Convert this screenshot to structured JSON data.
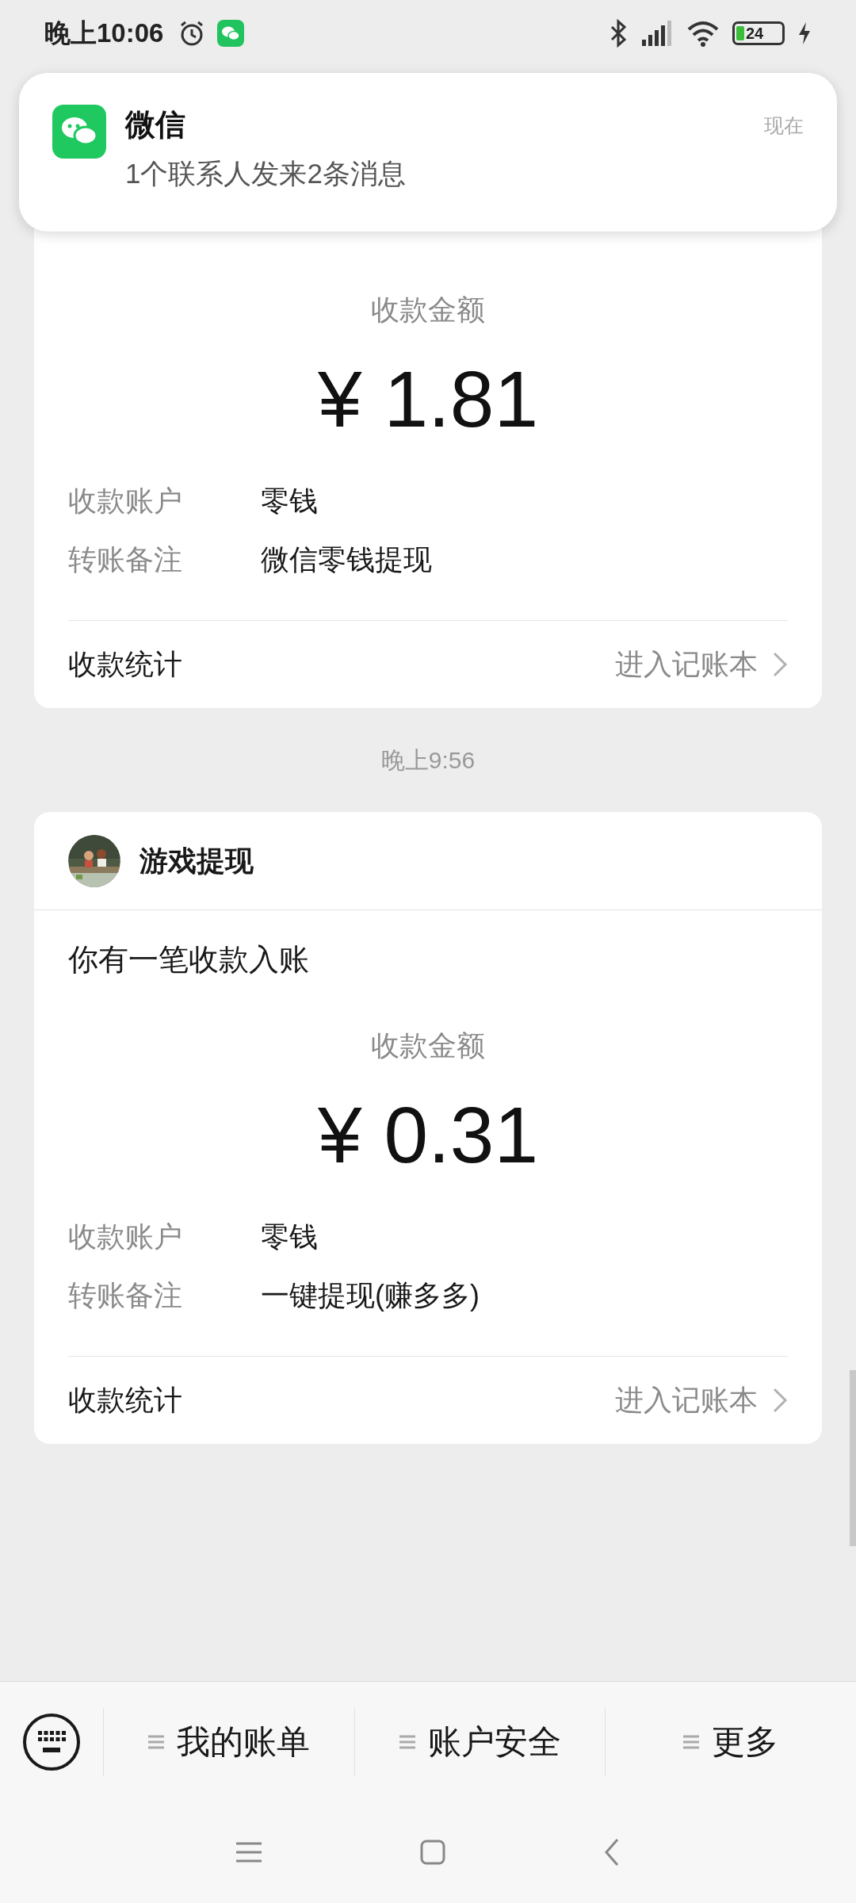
{
  "status_bar": {
    "time": "晚上10:06",
    "battery": "24"
  },
  "notification": {
    "app": "微信",
    "message": "1个联系人发来2条消息",
    "time": "现在"
  },
  "cards": [
    {
      "amount_label": "收款金额",
      "amount": "¥ 1.81",
      "rows": [
        {
          "label": "收款账户",
          "value": "零钱"
        },
        {
          "label": "转账备注",
          "value": "微信零钱提现"
        }
      ],
      "stats_label": "收款统计",
      "stats_link": "进入记账本"
    },
    {
      "timestamp": "晚上9:56",
      "sender": "游戏提现",
      "title": "你有一笔收款入账",
      "amount_label": "收款金额",
      "amount": "¥ 0.31",
      "rows": [
        {
          "label": "收款账户",
          "value": "零钱"
        },
        {
          "label": "转账备注",
          "value": "一键提现(赚多多)"
        }
      ],
      "stats_label": "收款统计",
      "stats_link": "进入记账本"
    }
  ],
  "menu": [
    "我的账单",
    "账户安全",
    "更多"
  ]
}
